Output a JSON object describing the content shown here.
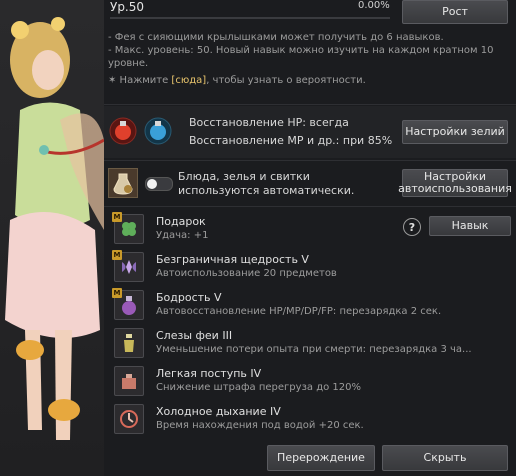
{
  "header": {
    "level": "Ур.50",
    "percent": "0.00%",
    "progress_fraction": 0.0,
    "grow_button": "Рост"
  },
  "info": {
    "line1": "- Фея с сияющими крылышками может получить до 6 навыков.",
    "line2": "- Макс. уровень: 50. Новый навык можно изучить на каждом кратном 10 уровне.",
    "line3_prefix": "✶ Нажмите ",
    "line3_link": "[сюда]",
    "line3_suffix": ", чтобы узнать о вероятности."
  },
  "potion": {
    "hp_text": "Восстановление HP: всегда",
    "mp_text": "Восстановление MP и др.: при 85%",
    "settings_button": "Настройки зелий"
  },
  "auto": {
    "text": "Блюда, зелья и свитки используются автоматически.",
    "toggle_on": false,
    "settings_button": "Настройки автоиспользования"
  },
  "skills": [
    {
      "name": "Подарок",
      "desc": "Удача: +1",
      "master": true,
      "icon": "clover-icon"
    },
    {
      "name": "Безграничная щедрость V",
      "desc": "Автоиспользование 20 предметов",
      "master": true,
      "icon": "fairy-icon"
    },
    {
      "name": "Бодрость V",
      "desc": "Автовосстановление HP/MP/DP/FP: перезарядка 2 сек.",
      "master": true,
      "icon": "potion-icon"
    },
    {
      "name": "Слезы феи III",
      "desc": "Уменьшение потери опыта при смерти: перезарядка 3 ча...",
      "master": false,
      "icon": "tear-vial-icon"
    },
    {
      "name": "Легкая поступь IV",
      "desc": "Снижение штрафа перегруза до 120%",
      "master": false,
      "icon": "weight-icon"
    },
    {
      "name": "Холодное дыхание IV",
      "desc": "Время нахождения под водой +20 сек.",
      "master": false,
      "icon": "breath-icon"
    }
  ],
  "skill_button": "Навык",
  "help_symbol": "?",
  "footer": {
    "rebirth_button": "Перерождение",
    "hide_button": "Скрыть"
  },
  "colors": {
    "background": "#1b1c1f",
    "accent_gold": "#e8c46c",
    "button": "#434448"
  }
}
